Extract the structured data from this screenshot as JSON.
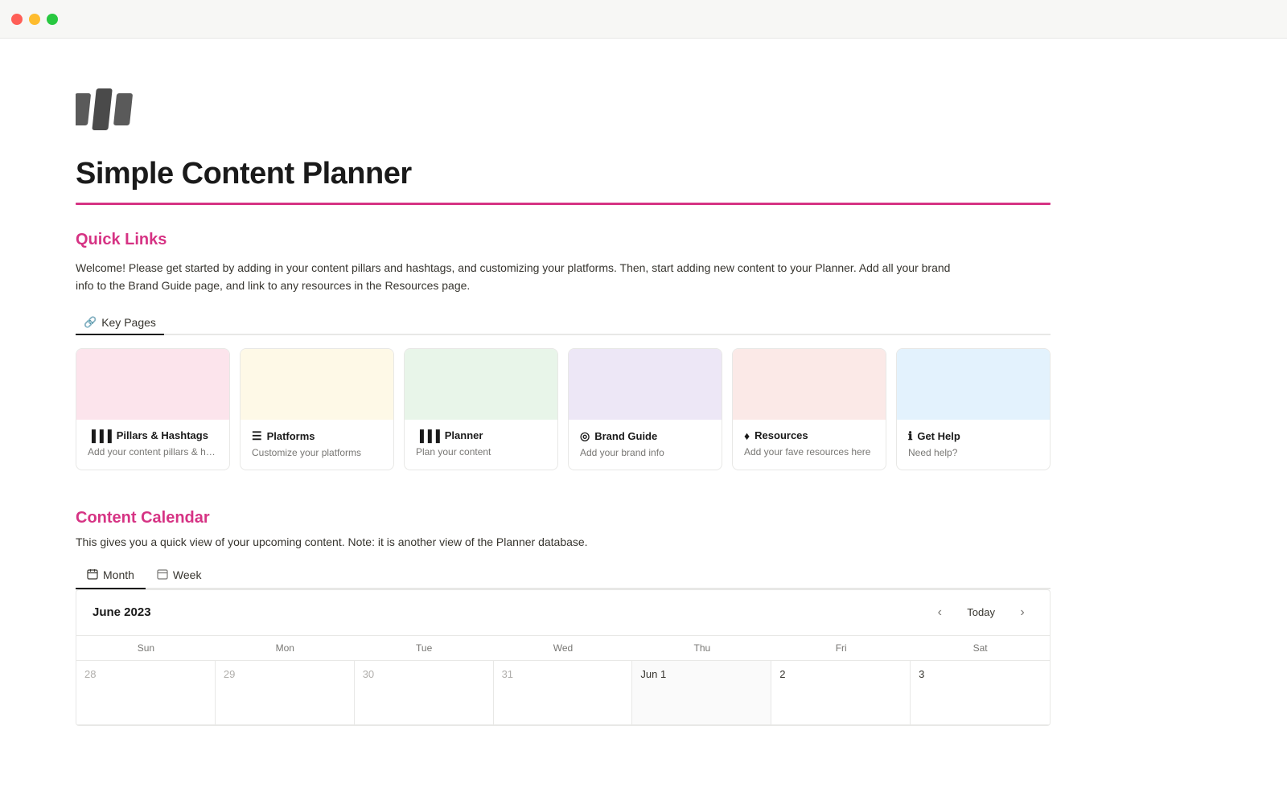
{
  "titlebar": {
    "traffic_lights": [
      "red",
      "yellow",
      "green"
    ]
  },
  "page": {
    "title": "Simple Content Planner",
    "divider_color": "#d63384"
  },
  "quick_links": {
    "heading": "Quick Links",
    "description": "Welcome! Please get started by adding in your content pillars and hashtags, and customizing your platforms. Then, start adding new content to your Planner. Add all your brand info to the Brand Guide page, and link to any resources in the Resources page.",
    "tab_label": "Key Pages",
    "tab_icon": "🔗"
  },
  "cards": [
    {
      "color": "#fce4ec",
      "icon": "▐▐▐",
      "title": "Pillars & Hashtags",
      "subtitle": "Add your content pillars & hasht..."
    },
    {
      "color": "#fef9e7",
      "icon": "☰☰",
      "title": "Platforms",
      "subtitle": "Customize your platforms"
    },
    {
      "color": "#e8f5e9",
      "icon": "▐▐▐",
      "title": "Planner",
      "subtitle": "Plan your content"
    },
    {
      "color": "#ede7f6",
      "icon": "◎",
      "title": "Brand Guide",
      "subtitle": "Add your brand info"
    },
    {
      "color": "#fbe9e7",
      "icon": "♦",
      "title": "Resources",
      "subtitle": "Add your fave resources here"
    },
    {
      "color": "#e3f2fd",
      "icon": "ℹ",
      "title": "Get Help",
      "subtitle": "Need help?"
    }
  ],
  "content_calendar": {
    "heading": "Content Calendar",
    "description": "This gives you a quick view of your upcoming content. Note: it is another view of the Planner database.",
    "tabs": [
      "Month",
      "Week"
    ],
    "active_tab": "Month",
    "month_title": "June 2023",
    "today_label": "Today",
    "day_headers": [
      "Sun",
      "Mon",
      "Tue",
      "Wed",
      "Thu",
      "Fri",
      "Sat"
    ],
    "calendar_rows": [
      [
        {
          "date": "28",
          "faded": true
        },
        {
          "date": "29",
          "faded": true
        },
        {
          "date": "30",
          "faded": true
        },
        {
          "date": "31",
          "faded": true
        },
        {
          "date": "Jun 1",
          "highlighted": false
        },
        {
          "date": "2",
          "highlighted": false
        },
        {
          "date": "3",
          "highlighted": false
        }
      ]
    ]
  }
}
